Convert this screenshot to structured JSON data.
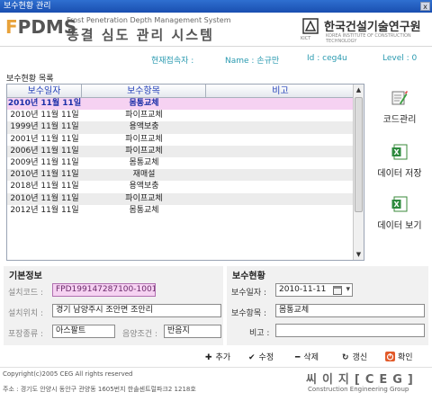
{
  "window": {
    "title": "보수현황 관리",
    "close_glyph": "x"
  },
  "header": {
    "logo_f": "F",
    "logo_rest": "PDMS",
    "system_en": "Frost Penetration Depth Management System",
    "system_kr": "동결 심도 관리 시스템",
    "org_emblem_label": "KICT",
    "org_kr": "한국건설기술연구원",
    "org_en": "KOREA INSTITUTE OF CONSTRUCTION TECHNOLOGY"
  },
  "userbar": {
    "current_user_label": "현재접속자 :",
    "name_label": "Name : 손규만",
    "id_label": "Id : ceg4u",
    "level_label": "Level : 0"
  },
  "list": {
    "section_title": "보수현황 목록",
    "columns": [
      "보수일자",
      "보수항목",
      "비고"
    ],
    "rows": [
      {
        "date": "2010년 11월 11일",
        "item": "몸통교체",
        "note": "",
        "selected": true
      },
      {
        "date": "2010년 11월 11일",
        "item": "파이프교체",
        "note": ""
      },
      {
        "date": "1999년 11월 11일",
        "item": "용액보충",
        "note": ""
      },
      {
        "date": "2001년 11월 11일",
        "item": "파이프교체",
        "note": ""
      },
      {
        "date": "2006년 11월 11일",
        "item": "파이프교체",
        "note": ""
      },
      {
        "date": "2009년 11월 11일",
        "item": "몸통교체",
        "note": ""
      },
      {
        "date": "2010년 11월 11일",
        "item": "재매설",
        "note": ""
      },
      {
        "date": "2018년 11월 11일",
        "item": "용액보충",
        "note": ""
      },
      {
        "date": "2010년 11월 11일",
        "item": "파이프교체",
        "note": ""
      },
      {
        "date": "2012년 11월 11일",
        "item": "몸통교체",
        "note": ""
      }
    ]
  },
  "side_buttons": {
    "code_manage": "코드관리",
    "data_save": "데이터 저장",
    "data_view": "데이터 보기"
  },
  "basic_info": {
    "title": "기본정보",
    "install_code_label": "설치코드 :",
    "install_code_value": "FPD199147287100-1001",
    "install_location_label": "설치위치 :",
    "install_location_value": "경기 남양주시 조안면 조안리",
    "pavement_label": "포장종류 :",
    "pavement_value": "아스팔트",
    "sun_label": "음양조건 :",
    "sun_value": "반음지"
  },
  "repair_status": {
    "title": "보수현황",
    "date_label": "보수일자 :",
    "date_value": "2010-11-11",
    "item_label": "보수항목 :",
    "item_value": "몸통교체",
    "note_label": "비고 :",
    "note_value": ""
  },
  "actions": {
    "add": "추가",
    "edit": "수정",
    "delete": "삭제",
    "refresh": "갱신",
    "confirm": "확인"
  },
  "footer": {
    "copyright": "Copyright(c)2005 CEG All rights reserved",
    "address": "주소 : 경기도 안양시 동안구 관양동 1605번지 한솔센트럴파크2 1218호",
    "company_kr": "씨이지[CEG]",
    "company_en": "Construction  Engineering  Group"
  },
  "colors": {
    "accent_blue": "#223fb8",
    "selected_row": "#f6d2f2",
    "userbar_text": "#2a9ab0",
    "logo_orange": "#e8a23a"
  }
}
